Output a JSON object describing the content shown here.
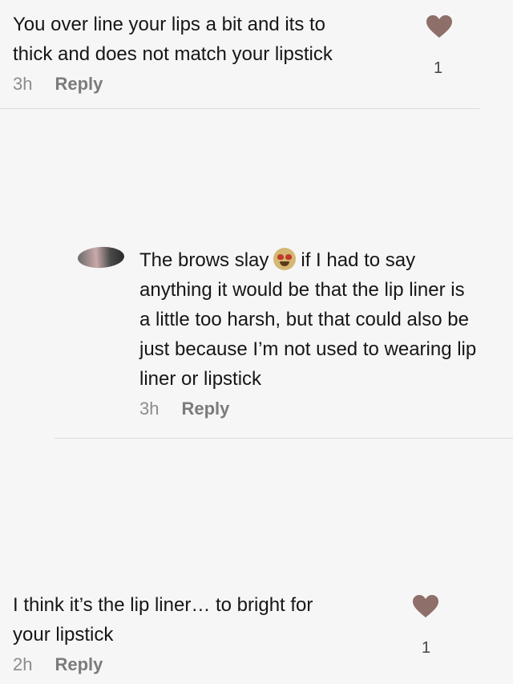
{
  "comments": [
    {
      "text_lines": [
        "You over line your lips a bit and its to",
        "thick and does not match your lipstick"
      ],
      "time": "3h",
      "reply_label": "Reply",
      "likes": "1"
    },
    {
      "text_part1": "The brows slay",
      "emoji": "heart-eyes-emoji",
      "text_part2": "if I had to say",
      "text_lines": [
        "anything it would be that the lip liner is",
        "a little too harsh, but that could also be",
        "just because I’m not used to wearing lip",
        "liner or lipstick"
      ],
      "time": "3h",
      "reply_label": "Reply"
    },
    {
      "text_lines": [
        "I think it’s the lip liner… to bright for",
        "your lipstick"
      ],
      "time": "2h",
      "reply_label": "Reply",
      "likes": "1"
    }
  ],
  "colors": {
    "heart": "#8e6f69",
    "background": "#f6f6f6"
  }
}
